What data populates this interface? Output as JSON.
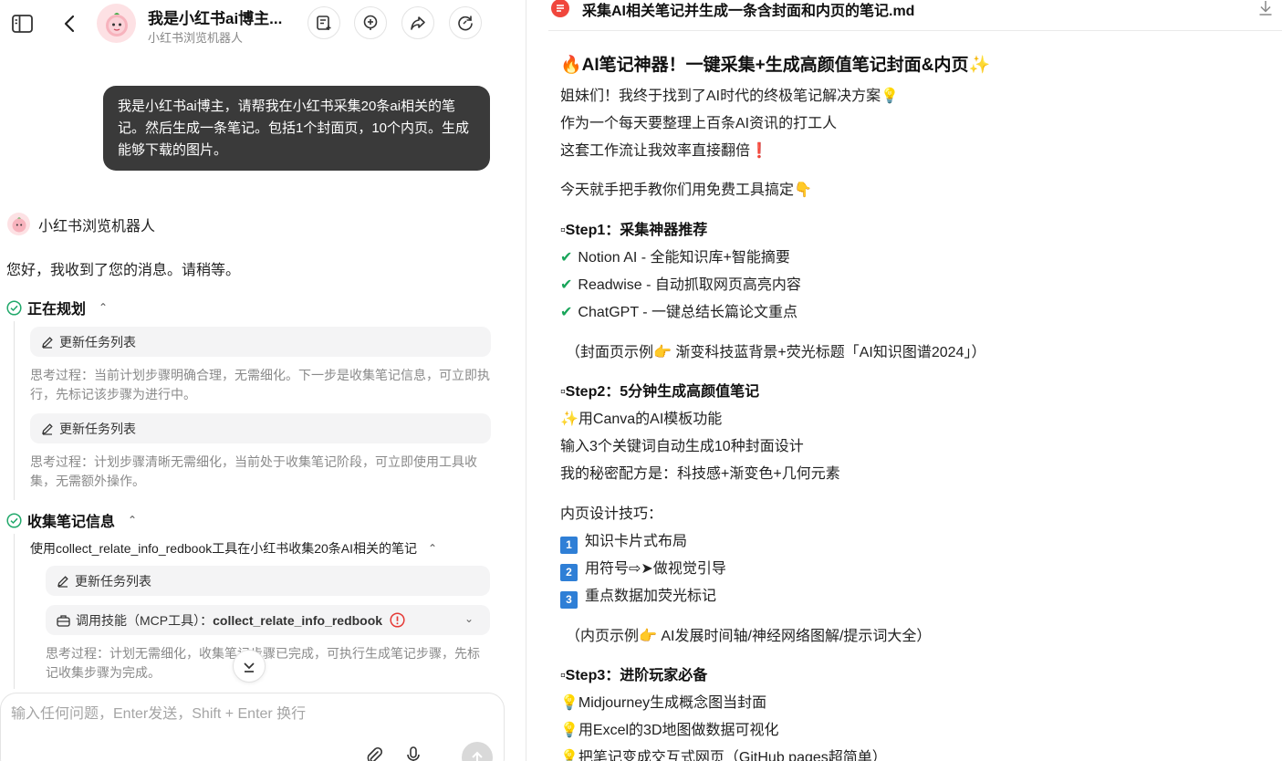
{
  "header": {
    "title": "我是小红书ai博主...",
    "subtitle": "小红书浏览机器人"
  },
  "user_message": "我是小红书ai博主，请帮我在小红书采集20条ai相关的笔记。然后生成一条笔记。包括1个封面页，10个内页。生成能够下载的图片。",
  "bot": {
    "name": "小红书浏览机器人",
    "greeting": "您好，我收到了您的消息。请稍等。"
  },
  "sections": {
    "planning": {
      "title": "正在规划",
      "pill1": "更新任务列表",
      "think1": "思考过程：当前计划步骤明确合理，无需细化。下一步是收集笔记信息，可立即执行，先标记该步骤为进行中。",
      "pill2": "更新任务列表",
      "think2": "思考过程：计划步骤清晰无需细化，当前处于收集笔记阶段，可立即使用工具收集，无需额外操作。"
    },
    "collect": {
      "title": "收集笔记信息",
      "subtask": "使用collect_relate_info_redbook工具在小红书收集20条AI相关的笔记",
      "pill1": "更新任务列表",
      "skill_prefix": "调用技能（MCP工具）：",
      "skill_name": "collect_relate_info_redbook",
      "think": "思考过程：计划无需细化，收集笔记步骤已完成，可执行生成笔记步骤，先标记收集步骤为完成。"
    }
  },
  "input": {
    "placeholder": "输入任何问题，Enter发送，Shift + Enter 换行"
  },
  "document": {
    "title": "采集AI相关笔记并生成一条含封面和内页的笔记.md",
    "heading": "AI笔记神器！一键采集+生成高颜值笔记封面&内页",
    "intro1": "姐妹们！我终于找到了AI时代的终极笔记解决方案",
    "intro2": "作为一个每天要整理上百条AI资讯的打工人",
    "intro3": "这套工作流让我效率直接翻倍",
    "intro4": "今天就手把手教你们用免费工具搞定",
    "step1": "▫Step1：采集神器推荐",
    "step1_items": [
      "Notion AI - 全能知识库+智能摘要",
      "Readwise - 自动抓取网页高亮内容",
      "ChatGPT - 一键总结长篇论文重点"
    ],
    "cover_example": "（封面页示例",
    "cover_example_rest": " 渐变科技蓝背景+荧光标题「AI知识图谱2024」）",
    "step2": "▫Step2：5分钟生成高颜值笔记",
    "step2_a": "用Canva的AI模板功能",
    "step2_b": "输入3个关键词自动生成10种封面设计",
    "step2_c": "我的秘密配方是：科技感+渐变色+几何元素",
    "inner_tips": "内页设计技巧：",
    "tips": [
      "知识卡片式布局",
      "用符号⇨➤做视觉引导",
      "重点数据加荧光标记"
    ],
    "tip_nums": [
      "1",
      "2",
      "3"
    ],
    "inner_example": "（内页示例",
    "inner_example_rest": " AI发展时间轴/神经网络图解/提示词大全）",
    "step3": "▫Step3：进阶玩家必备",
    "step3_items": [
      "Midjourney生成概念图当封面",
      "用Excel的3D地图做数据可视化",
      "把笔记变成交互式网页（GitHub pages超简单）"
    ]
  }
}
